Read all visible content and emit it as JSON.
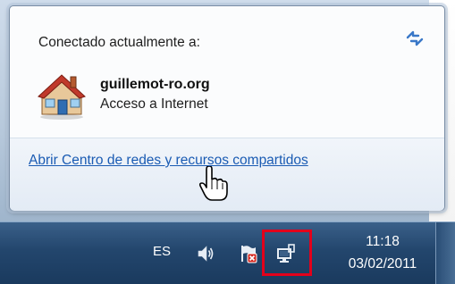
{
  "flyout": {
    "header": "Conectado actualmente a:",
    "network": {
      "name": "guillemot-ro.org",
      "status": "Acceso a Internet"
    },
    "link": "Abrir Centro de redes y recursos compartidos"
  },
  "taskbar": {
    "language": "ES",
    "clock": {
      "time": "11:18",
      "date": "03/02/2011"
    },
    "tray_icons": [
      "speaker-icon",
      "action-center-flag-icon",
      "network-icon"
    ]
  },
  "colors": {
    "link": "#1a5bb3",
    "highlight_box": "#e3001b",
    "taskbar": "#23466d"
  }
}
